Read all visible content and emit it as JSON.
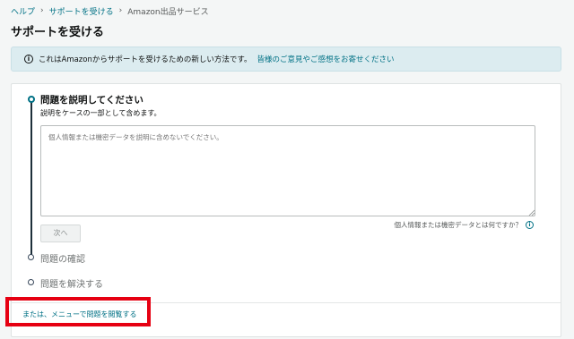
{
  "breadcrumb": {
    "items": [
      "ヘルプ",
      "サポートを受ける",
      "Amazon出品サービス"
    ]
  },
  "page": {
    "title": "サポートを受ける"
  },
  "banner": {
    "text": "これはAmazonからサポートを受けるための新しい方法です。",
    "link": "皆様のご意見やご感想をお寄せください",
    "icon": "info-icon"
  },
  "steps": {
    "step1": {
      "title": "問題を説明してください",
      "subtitle": "説明をケースの一部として含めます。",
      "textarea_placeholder": "個人情報または機密データを説明に含めないでください。",
      "help_text": "個人情報または機密データとは何ですか？",
      "next_label": "次へ"
    },
    "step2_label": "問題の確認",
    "step3_label": "問題を解決する"
  },
  "footer": {
    "menu_link": "または、メニューで問題を閲覧する"
  },
  "colors": {
    "link": "#007185",
    "highlight": "#e60012",
    "banner_bg": "#dcecf0"
  }
}
